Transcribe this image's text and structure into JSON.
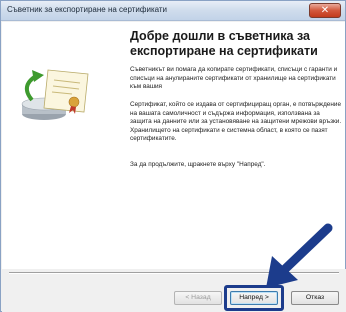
{
  "window": {
    "title": "Съветник за експортиране на сертификати",
    "close_glyph": "✕"
  },
  "content": {
    "heading": "Добре дошли в съветника за експортиране на сертификати",
    "paragraph_1": "Съветникът ви помага да копирате сертификати, списъци с гаранти и списъци на анулираните сертификати от хранилище на сертификати към вашия",
    "paragraph_2": "Сертификат, който се издава от сертифициращ орган, е потвърждение на вашата самоличност и съдържа информация, използвана за защита на данните или за установяване на защитени мрежови връзки. Хранилището на сертификати е системна област, в която се пазят сертификатите.",
    "paragraph_3": "За да продължите, щракнете върху \"Напред\"."
  },
  "buttons": {
    "back": "< Назад",
    "next": "Напред >",
    "cancel": "Отказ"
  },
  "icons": {
    "wizard_graphic": "certificate-export-icon",
    "arrow": "pointer-arrow-icon"
  },
  "colors": {
    "arrow": "#1c3c8c",
    "highlight": "#1c3c8c"
  }
}
